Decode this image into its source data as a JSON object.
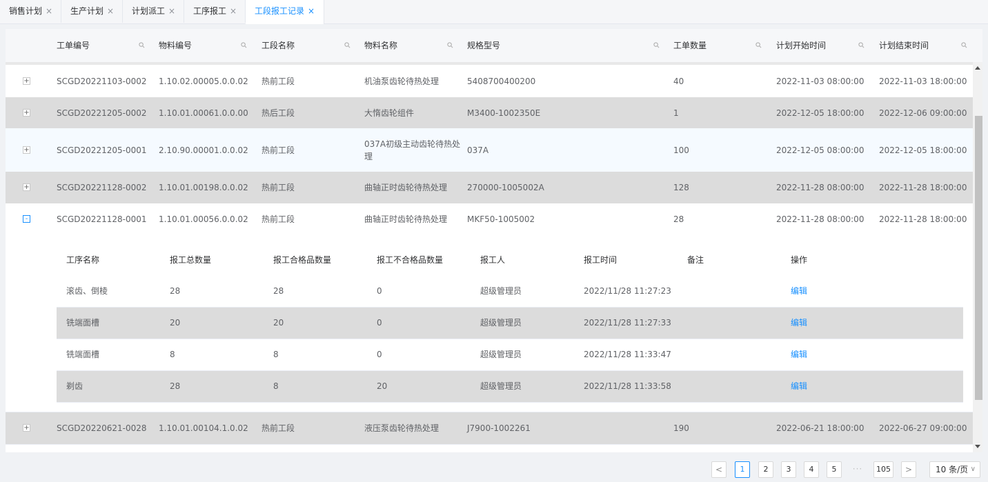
{
  "tabs": [
    {
      "label": "销售计划",
      "close": "×"
    },
    {
      "label": "生产计划",
      "close": "×"
    },
    {
      "label": "计划派工",
      "close": "×"
    },
    {
      "label": "工序报工",
      "close": "×"
    },
    {
      "label": "工段报工记录",
      "close": "×"
    }
  ],
  "table": {
    "headers": [
      "工单编号",
      "物料编号",
      "工段名称",
      "物料名称",
      "规格型号",
      "工单数量",
      "计划开始时间",
      "计划结束时间"
    ],
    "rows_top": [
      {
        "expand": "+",
        "order": "SCGD20221103-0002",
        "material_no": "1.10.02.00005.0.0.02",
        "section": "热前工段",
        "material_name": "机油泵齿轮待热处理",
        "spec": "5408700400200",
        "qty": "40",
        "start": "2022-11-03 08:00:00",
        "end": "2022-11-03 18:00:00"
      },
      {
        "expand": "+",
        "order": "SCGD20221205-0002",
        "material_no": "1.10.01.00061.0.0.00",
        "section": "热后工段",
        "material_name": "大惰齿轮组件",
        "spec": "M3400-1002350E",
        "qty": "1",
        "start": "2022-12-05 18:00:00",
        "end": "2022-12-06 09:00:00"
      },
      {
        "expand": "+",
        "order": "SCGD20221205-0001",
        "material_no": "2.10.90.00001.0.0.02",
        "section": "热前工段",
        "material_name": "037A初级主动齿轮待热处理",
        "spec": "037A",
        "qty": "100",
        "start": "2022-12-05 08:00:00",
        "end": "2022-12-05 18:00:00"
      },
      {
        "expand": "+",
        "order": "SCGD20221128-0002",
        "material_no": "1.10.01.00198.0.0.02",
        "section": "热前工段",
        "material_name": "曲轴正时齿轮待热处理",
        "spec": "270000-1005002A",
        "qty": "128",
        "start": "2022-11-28 08:00:00",
        "end": "2022-11-28 18:00:00"
      },
      {
        "expand": "-",
        "order": "SCGD20221128-0001",
        "material_no": "1.10.01.00056.0.0.02",
        "section": "热前工段",
        "material_name": "曲轴正时齿轮待热处理",
        "spec": "MKF50-1005002",
        "qty": "28",
        "start": "2022-11-28 08:00:00",
        "end": "2022-11-28 18:00:00"
      }
    ],
    "row_bottom": {
      "expand": "+",
      "order": "SCGD20220621-0028",
      "material_no": "1.10.01.00104.1.0.02",
      "section": "热前工段",
      "material_name": "液压泵齿轮待热处理",
      "spec": "J7900-1002261",
      "qty": "190",
      "start": "2022-06-21 18:00:00",
      "end": "2022-06-27 09:00:00"
    }
  },
  "nested": {
    "headers": [
      "工序名称",
      "报工总数量",
      "报工合格品数量",
      "报工不合格品数量",
      "报工人",
      "报工时间",
      "备注",
      "操作"
    ],
    "rows": [
      {
        "process": "滚齿、倒棱",
        "total": "28",
        "good": "28",
        "bad": "0",
        "worker": "超级管理员",
        "time": "2022/11/28 11:27:23",
        "note": "",
        "action": "编辑"
      },
      {
        "process": "铣端面槽",
        "total": "20",
        "good": "20",
        "bad": "0",
        "worker": "超级管理员",
        "time": "2022/11/28 11:27:33",
        "note": "",
        "action": "编辑"
      },
      {
        "process": "铣端面槽",
        "total": "8",
        "good": "8",
        "bad": "0",
        "worker": "超级管理员",
        "time": "2022/11/28 11:33:47",
        "note": "",
        "action": "编辑"
      },
      {
        "process": "剃齿",
        "total": "28",
        "good": "8",
        "bad": "20",
        "worker": "超级管理员",
        "time": "2022/11/28 11:33:58",
        "note": "",
        "action": "编辑"
      }
    ]
  },
  "pagination": {
    "prev": "<",
    "pages": [
      "1",
      "2",
      "3",
      "4",
      "5"
    ],
    "ellipsis": "···",
    "last": "105",
    "next": ">",
    "current": "1",
    "page_size": "10 条/页",
    "page_size_chevron": "∨"
  },
  "colors": {
    "accent": "#1890ff",
    "stripe": "#dcdcdc",
    "header_bg": "#f6f7f9"
  },
  "icons": [
    "search-icon",
    "close-icon",
    "expand-icon",
    "collapse-icon",
    "chevron-left-icon",
    "chevron-right-icon",
    "chevron-down-icon"
  ]
}
